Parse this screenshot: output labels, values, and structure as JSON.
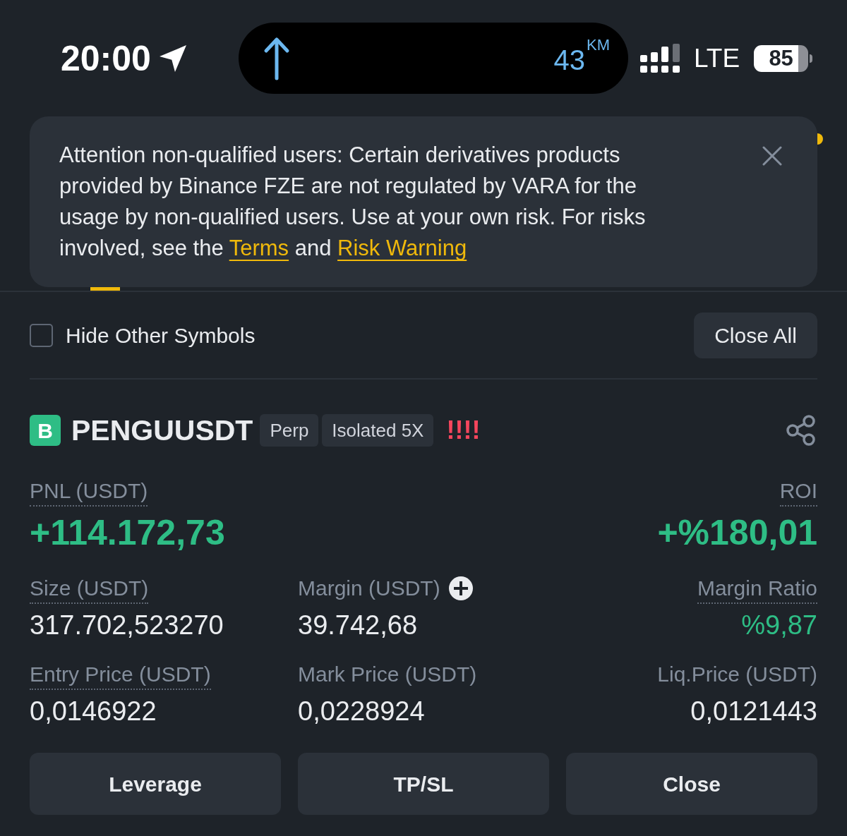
{
  "status_bar": {
    "time": "20:00",
    "distance": "43$^{KM}$",
    "network": "LTE",
    "battery": "85"
  },
  "notice": {
    "segments": [
      {
        "kind": "text",
        "text": "Attention non-qualified users: Certain derivatives products provided by Binance FZE are not regulated by VARA for the usage by non-qualified users. Use at your own risk. For risks involved, see the "
      },
      {
        "kind": "link",
        "text": "Terms"
      },
      {
        "kind": "text",
        "text": " and "
      },
      {
        "kind": "link",
        "text": "Risk Warning"
      }
    ]
  },
  "filter": {
    "label": "Hide Other Symbols",
    "checked": false
  },
  "close_all": "Close All",
  "position": {
    "badge": "B",
    "symbol": "PENGUUSDT",
    "tags": [
      "Perp",
      "Isolated 5X"
    ],
    "warning": "!!!!",
    "pnl": {
      "label": "PNL (USDT)",
      "value": "+114.172,73",
      "positive": true
    },
    "roi": {
      "label": "ROI",
      "value": "+%180,01",
      "positive": true
    },
    "fields": [
      {
        "label": "Size (USDT)",
        "value": "317.702,523270",
        "dotted": true,
        "add_button": false,
        "positive": false
      },
      {
        "label": "Margin (USDT)",
        "value": "39.742,68",
        "dotted": false,
        "add_button": true,
        "positive": false
      },
      {
        "label": "Margin Ratio",
        "value": "%9,87",
        "dotted": true,
        "add_button": false,
        "positive": true
      },
      {
        "label": "Entry Price (USDT)",
        "value": "0,0146922",
        "dotted": true,
        "add_button": false,
        "positive": false
      },
      {
        "label": "Mark Price (USDT)",
        "value": "0,0228924",
        "dotted": false,
        "add_button": false,
        "positive": false
      },
      {
        "label": "Liq.Price (USDT)",
        "value": "0,0121443",
        "dotted": false,
        "add_button": false,
        "positive": false
      }
    ]
  },
  "actions": [
    "Leverage",
    "TP/SL",
    "Close"
  ]
}
